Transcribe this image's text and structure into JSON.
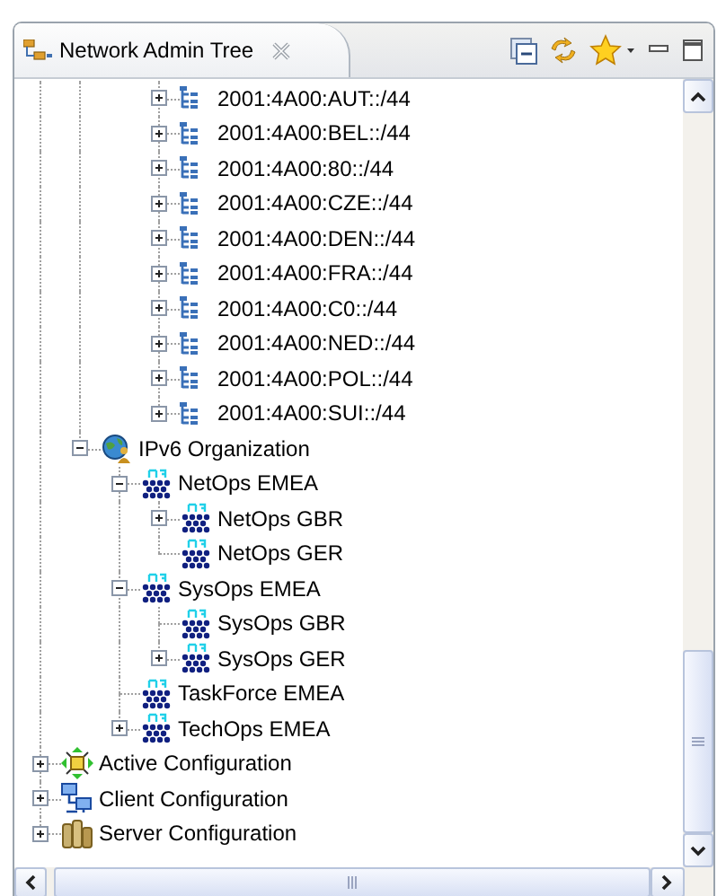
{
  "view": {
    "title": "Network Admin Tree"
  },
  "tree": [
    {
      "children": [
        {
          "children": [
            {
              "children": [
                {
                  "label": "2001:4A00:AUT::/44",
                  "kind": "prefix",
                  "expanded": false
                },
                {
                  "label": "2001:4A00:BEL::/44",
                  "kind": "prefix",
                  "expanded": false
                },
                {
                  "label": "2001:4A00:80::/44",
                  "kind": "prefix",
                  "expanded": false
                },
                {
                  "label": "2001:4A00:CZE::/44",
                  "kind": "prefix",
                  "expanded": false
                },
                {
                  "label": "2001:4A00:DEN::/44",
                  "kind": "prefix",
                  "expanded": false
                },
                {
                  "label": "2001:4A00:FRA::/44",
                  "kind": "prefix",
                  "expanded": false
                },
                {
                  "label": "2001:4A00:C0::/44",
                  "kind": "prefix",
                  "expanded": false
                },
                {
                  "label": "2001:4A00:NED::/44",
                  "kind": "prefix",
                  "expanded": false
                },
                {
                  "label": "2001:4A00:POL::/44",
                  "kind": "prefix",
                  "expanded": false
                },
                {
                  "label": "2001:4A00:SUI::/44",
                  "kind": "prefix",
                  "expanded": false
                }
              ]
            }
          ]
        },
        {
          "label": "IPv6 Organization",
          "kind": "organization",
          "expanded": true,
          "children": [
            {
              "label": "NetOps EMEA",
              "kind": "org",
              "expanded": true,
              "children": [
                {
                  "label": "NetOps GBR",
                  "kind": "org",
                  "expanded": false
                },
                {
                  "label": "NetOps GER",
                  "kind": "org"
                }
              ]
            },
            {
              "label": "SysOps EMEA",
              "kind": "org",
              "expanded": true,
              "children": [
                {
                  "label": "SysOps GBR",
                  "kind": "org"
                },
                {
                  "label": "SysOps GER",
                  "kind": "org",
                  "expanded": false
                }
              ]
            },
            {
              "label": "TaskForce EMEA",
              "kind": "org"
            },
            {
              "label": "TechOps EMEA",
              "kind": "org",
              "expanded": false
            }
          ]
        }
      ]
    },
    {
      "label": "Active Configuration",
      "kind": "active",
      "expanded": false
    },
    {
      "label": "Client Configuration",
      "kind": "client",
      "expanded": false
    },
    {
      "label": "Server Configuration",
      "kind": "server",
      "expanded": false
    }
  ]
}
